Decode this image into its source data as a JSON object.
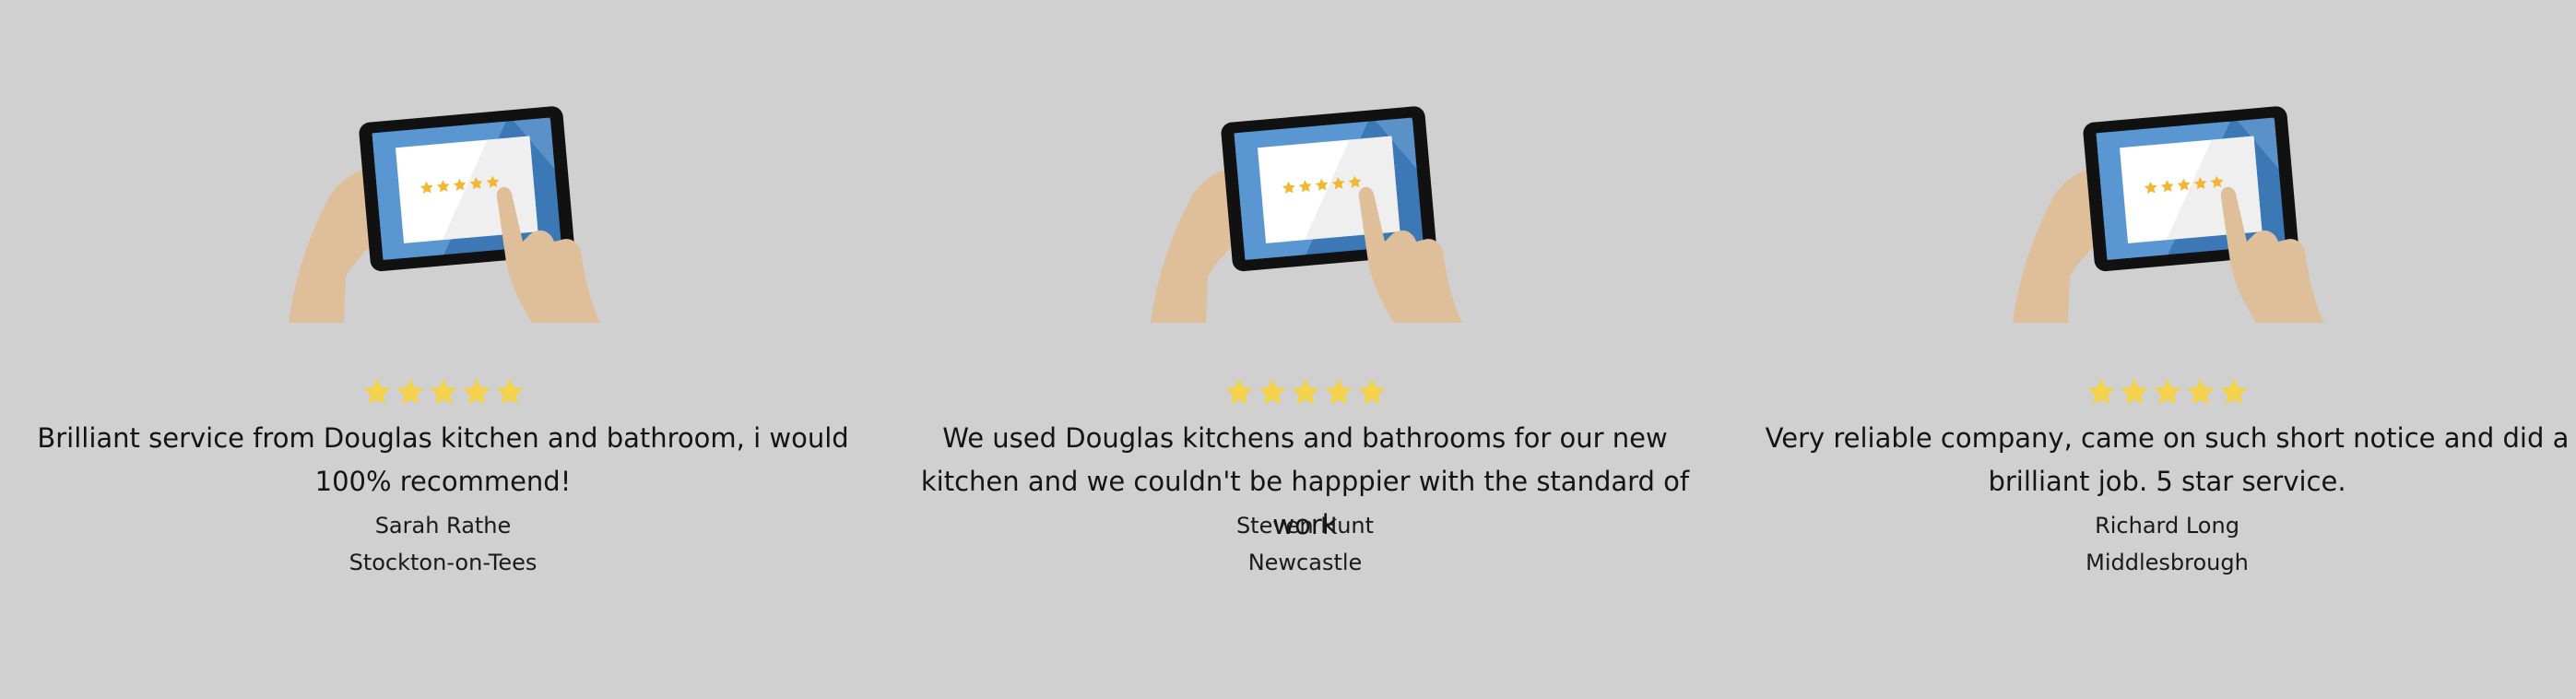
{
  "colors": {
    "background": "#d0d0d0",
    "star_yellow": "#f5d24b",
    "screen_blue": "#4d86c1",
    "skin": "#dfbf9a",
    "tablet_frame": "#111111"
  },
  "illustration": {
    "icon": "hands-holding-tablet-five-star-rating-icon"
  },
  "testimonials": [
    {
      "rating": 5,
      "quote": "Brilliant service from Douglas kitchen and bathroom, i would 100% recommend!",
      "name": "Sarah Rathe",
      "location": "Stockton-on-Tees"
    },
    {
      "rating": 5,
      "quote": "We used Douglas kitchens and bathrooms for our new kitchen and we couldn't be happpier with the standard of work",
      "name": "Steven Hunt",
      "location": "Newcastle"
    },
    {
      "rating": 5,
      "quote": "Very reliable company, came on such short notice and did a brilliant job. 5 star service.",
      "name": "Richard Long",
      "location": "Middlesbrough"
    }
  ]
}
